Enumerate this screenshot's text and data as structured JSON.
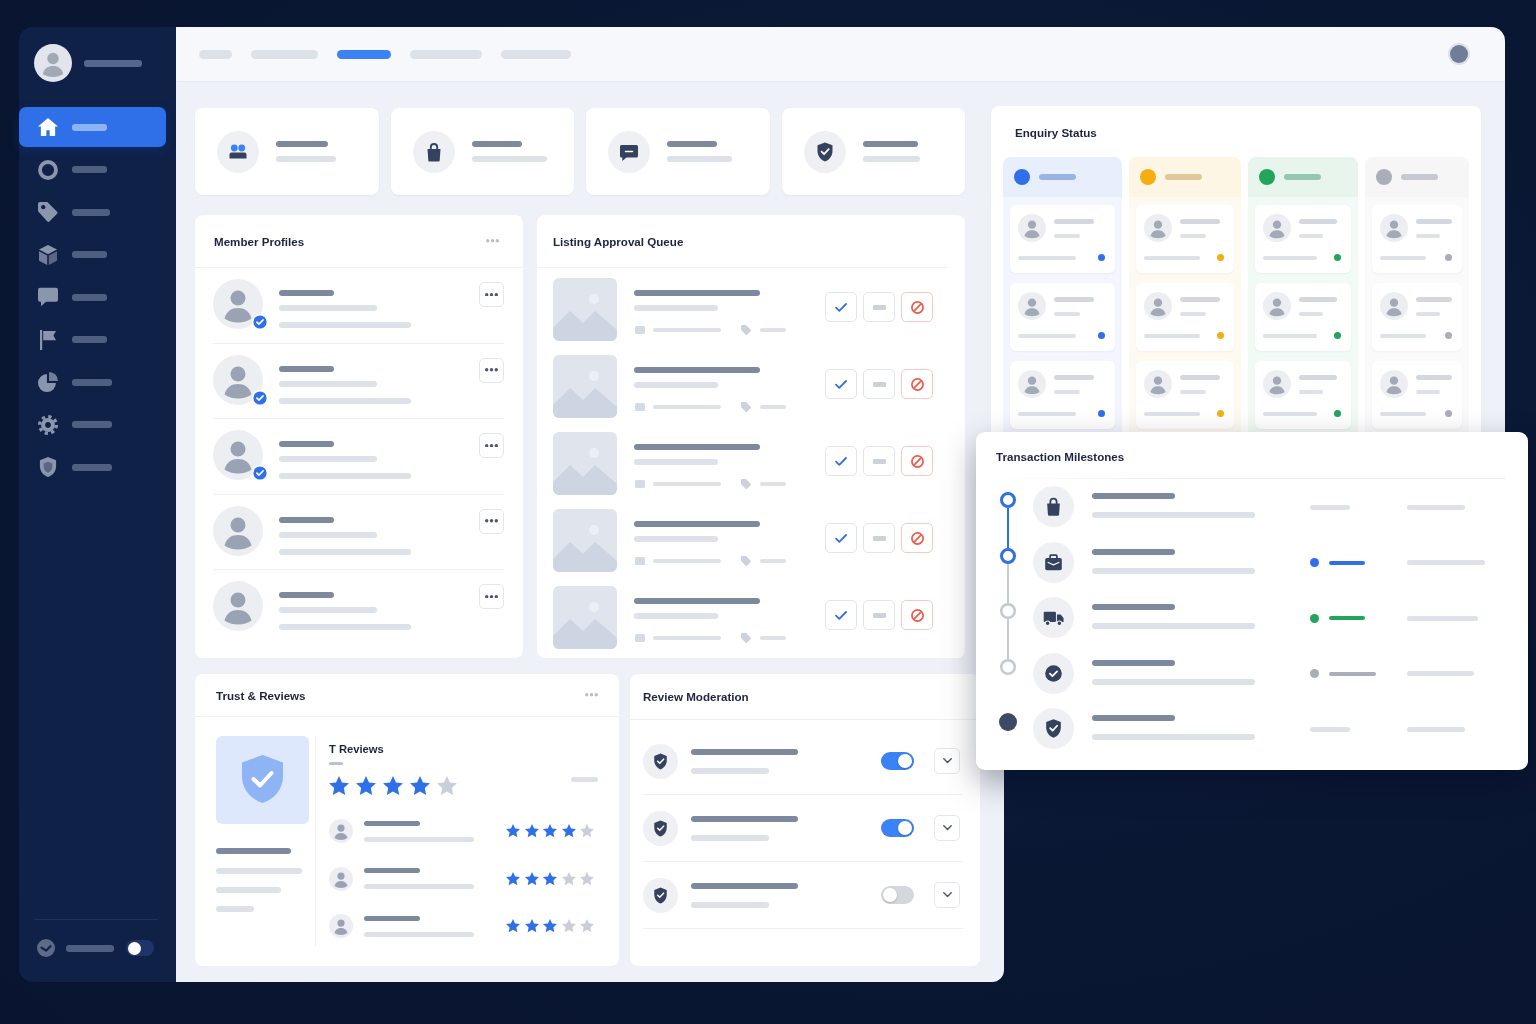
{
  "sidebar": {
    "items": [
      {
        "kind": "home",
        "selected": true
      },
      {
        "kind": "ring",
        "selected": false
      },
      {
        "kind": "tag",
        "selected": false
      },
      {
        "kind": "cube",
        "selected": false
      },
      {
        "kind": "chat",
        "selected": false
      },
      {
        "kind": "flag",
        "selected": false
      },
      {
        "kind": "chart",
        "selected": false
      },
      {
        "kind": "gear",
        "selected": false
      },
      {
        "kind": "shield",
        "selected": false
      }
    ],
    "footer_toggle": {
      "on": false
    }
  },
  "topbar": {
    "tabs": [
      {
        "selected": false
      },
      {
        "selected": false
      },
      {
        "selected": true
      },
      {
        "selected": false
      },
      {
        "selected": false
      }
    ]
  },
  "stat_cards": [
    {
      "kind": "members"
    },
    {
      "kind": "bag"
    },
    {
      "kind": "message"
    },
    {
      "kind": "shield"
    }
  ],
  "member_profiles": {
    "title": "Member Profiles",
    "rows": [
      {
        "verified": true
      },
      {
        "verified": true
      },
      {
        "verified": true
      },
      {
        "verified": false
      },
      {
        "verified": false
      }
    ]
  },
  "listing_approval_queue": {
    "title": "Listing Approval Queue",
    "rows": [
      {},
      {},
      {},
      {},
      {}
    ]
  },
  "enquiry_status": {
    "title": "Enquiry Status",
    "columns": [
      {
        "color": "#2f6fe8",
        "cards": [
          {
            "color": "#2f6fe8"
          },
          {
            "color": "#2f6fe8"
          },
          {
            "color": "#2f6fe8"
          }
        ]
      },
      {
        "color": "#f5ae12",
        "cards": [
          {
            "color": "#f5ae12"
          },
          {
            "color": "#f5ae12"
          },
          {
            "color": "#f5ae12"
          }
        ]
      },
      {
        "color": "#22a55a",
        "cards": [
          {
            "color": "#22a55a"
          },
          {
            "color": "#22a55a"
          },
          {
            "color": "#22a55a"
          }
        ]
      },
      {
        "color": "#a9aeb8",
        "cards": [
          {
            "color": "#a9aeb8"
          },
          {
            "color": "#a9aeb8"
          },
          {
            "color": "#a9aeb8"
          }
        ]
      }
    ]
  },
  "transaction_milestones": {
    "title": "Transaction Milestones",
    "steps": [
      {
        "kind": "bag",
        "completed": true,
        "final": false
      },
      {
        "kind": "briefcase",
        "completed": true,
        "final": false,
        "color": "#2f6fe8"
      },
      {
        "kind": "truck",
        "completed": false,
        "final": false,
        "color": "#22a55a"
      },
      {
        "kind": "check",
        "completed": false,
        "final": false,
        "color": "#a9aeb8"
      },
      {
        "kind": "shield",
        "completed": false,
        "final": true
      }
    ]
  },
  "trust_reviews": {
    "title": "Trust & Reviews",
    "summary": {
      "heading": "T Reviews",
      "stars": 4
    },
    "reviews": [
      {
        "stars": 4
      },
      {
        "stars": 3
      },
      {
        "stars": 3
      }
    ]
  },
  "review_moderation": {
    "title": "Review Moderation",
    "rows": [
      {
        "on": true
      },
      {
        "on": true
      },
      {
        "on": false
      }
    ]
  }
}
